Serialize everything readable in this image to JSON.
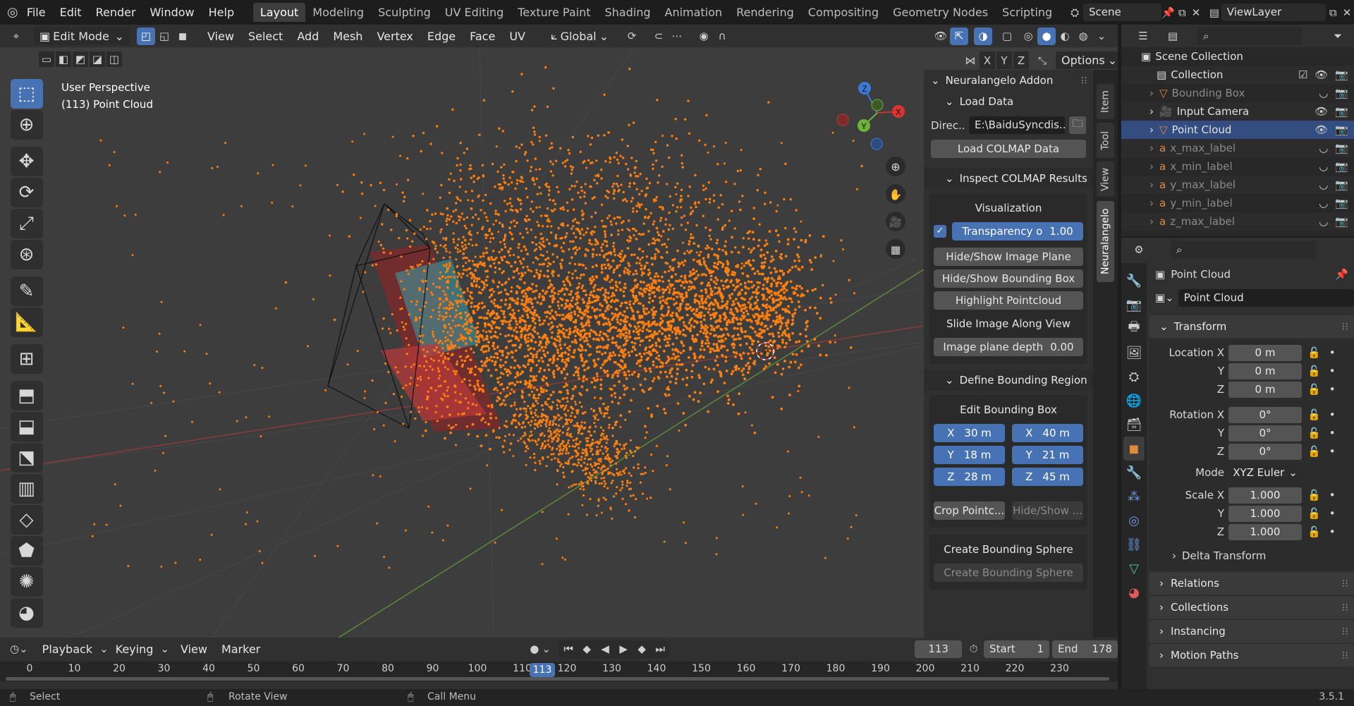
{
  "app": {
    "menus": [
      "File",
      "Edit",
      "Render",
      "Window",
      "Help"
    ]
  },
  "workspaces": [
    "Layout",
    "Modeling",
    "Sculpting",
    "UV Editing",
    "Texture Paint",
    "Shading",
    "Animation",
    "Rendering",
    "Compositing",
    "Geometry Nodes",
    "Scripting"
  ],
  "scene": {
    "name": "Scene",
    "view_layer": "ViewLayer"
  },
  "header3d": {
    "mode": "Edit Mode",
    "menus": [
      "View",
      "Select",
      "Add",
      "Mesh",
      "Vertex",
      "Edge",
      "Face",
      "UV"
    ],
    "orientation": "Global",
    "axes": [
      "X",
      "Y",
      "Z"
    ],
    "options": "Options"
  },
  "viewport": {
    "line1": "User Perspective",
    "line2": "(113) Point Cloud",
    "point_color": "#ff7f0e",
    "gizmo": {
      "z": "Z",
      "y": "Y",
      "x": "X"
    }
  },
  "npanel": {
    "addon_title": "Neuralangelo Addon",
    "load_data": "Load Data",
    "directory_label": "Direc...",
    "directory_value": "E:\\BaiduSyncdis...",
    "load_colmap": "Load COLMAP Data",
    "inspect_title": "Inspect COLMAP Results",
    "visualization": "Visualization",
    "transparency_label": "Transparency o",
    "transparency_value": "1.00",
    "hide_show_plane": "Hide/Show Image Plane",
    "hide_show_bbox": "Hide/Show Bounding Box",
    "highlight": "Highlight Pointcloud",
    "slide_image": "Slide Image Along View",
    "plane_depth_label": "Image plane depth",
    "plane_depth_value": "0.00",
    "define_title": "Define Bounding Region",
    "edit_bbox": "Edit Bounding Box",
    "bbox_min": [
      {
        "axis": "X",
        "value": "30 m"
      },
      {
        "axis": "Y",
        "value": "18 m"
      },
      {
        "axis": "Z",
        "value": "28 m"
      }
    ],
    "bbox_max": [
      {
        "axis": "X",
        "value": "40 m"
      },
      {
        "axis": "Y",
        "value": "21 m"
      },
      {
        "axis": "Z",
        "value": "45 m"
      }
    ],
    "crop_btn": "Crop Pointc...",
    "hide_show_short": "Hide/Show ...",
    "create_sphere_label": "Create Bounding Sphere",
    "create_sphere_btn": "Create Bounding Sphere",
    "tabs": [
      "Item",
      "Tool",
      "View",
      "Neuralangelo"
    ]
  },
  "outliner": {
    "root": "Scene Collection",
    "items": [
      {
        "name": "Collection"
      },
      {
        "name": "Bounding Box"
      },
      {
        "name": "Input Camera"
      },
      {
        "name": "Point Cloud"
      },
      {
        "name": "x_max_label"
      },
      {
        "name": "x_min_label"
      },
      {
        "name": "y_max_label"
      },
      {
        "name": "y_min_label"
      },
      {
        "name": "z_max_label"
      }
    ]
  },
  "properties": {
    "object_name": "Point Cloud",
    "data_name": "Point Cloud",
    "transform_title": "Transform",
    "location": [
      {
        "label": "Location X",
        "value": "0 m"
      },
      {
        "label": "Y",
        "value": "0 m"
      },
      {
        "label": "Z",
        "value": "0 m"
      }
    ],
    "rotation": [
      {
        "label": "Rotation X",
        "value": "0°"
      },
      {
        "label": "Y",
        "value": "0°"
      },
      {
        "label": "Z",
        "value": "0°"
      }
    ],
    "mode_label": "Mode",
    "mode_value": "XYZ Euler",
    "scale": [
      {
        "label": "Scale X",
        "value": "1.000"
      },
      {
        "label": "Y",
        "value": "1.000"
      },
      {
        "label": "Z",
        "value": "1.000"
      }
    ],
    "delta": "Delta Transform",
    "sections": [
      "Relations",
      "Collections",
      "Instancing",
      "Motion Paths"
    ]
  },
  "timeline": {
    "menus": [
      "Playback",
      "Keying",
      "View",
      "Marker"
    ],
    "current_frame": "113",
    "start_label": "Start",
    "start": "1",
    "end_label": "End",
    "end": "178",
    "ticks": [
      "0",
      "10",
      "20",
      "30",
      "40",
      "50",
      "60",
      "70",
      "80",
      "90",
      "100",
      "110",
      "120",
      "130",
      "140",
      "150",
      "160",
      "170",
      "180",
      "190",
      "200",
      "210",
      "220",
      "230"
    ]
  },
  "status": {
    "select": "Select",
    "rotate": "Rotate View",
    "menu": "Call Menu",
    "version": "3.5.1"
  }
}
